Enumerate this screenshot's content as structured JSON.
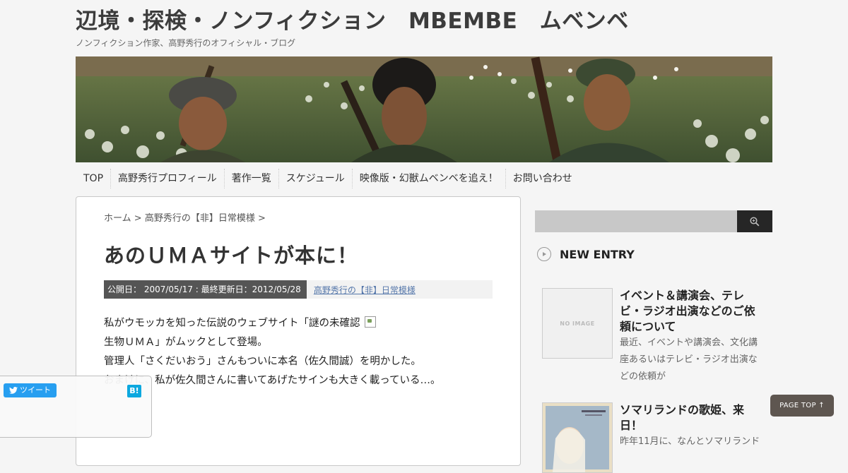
{
  "site": {
    "title": "辺境・探検・ノンフィクション　MBEMBE　ムベンベ",
    "description": "ノンフィクション作家、高野秀行のオフィシャル・ブログ"
  },
  "nav": {
    "items": [
      {
        "label": "TOP"
      },
      {
        "label": "高野秀行プロフィール"
      },
      {
        "label": "著作一覧"
      },
      {
        "label": "スケジュール"
      },
      {
        "label": "映像版・幻獣ムベンベを追え！"
      },
      {
        "label": "お問い合わせ"
      }
    ]
  },
  "breadcrumb": {
    "home": "ホーム",
    "sep": ">",
    "category": "高野秀行の【非】日常模様"
  },
  "post": {
    "title": "あのＵＭＡサイトが本に！",
    "dates": "公開日： 2007/05/17 : 最終更新日：2012/05/28",
    "category": "高野秀行の【非】日常模様",
    "paragraphs": [
      "私がウモッカを知った伝説のウェブサイト「謎の未確認",
      "生物ＵＭＡ」がムックとして登場。",
      "管理人「さくだいおう」さんもついに本名（佐久間誠）を明かした。",
      "おまけに、私が佐久間さんに書いてあげたサインも大きく載っている…。"
    ]
  },
  "share": {
    "tweet_label": "ツイート",
    "hatena_label": "B!"
  },
  "sidebar": {
    "widget_title": "NEW ENTRY",
    "entries": [
      {
        "title": "イベント＆講演会、テレビ・ラジオ出演などのご依頼について",
        "thumb_label": "NO IMAGE",
        "excerpt": "最近、イベントや講演会、文化講座あるいはテレビ・ラジオ出演などの依頼が"
      },
      {
        "title": "ソマリランドの歌姫、来日！",
        "excerpt": "昨年11月に、なんとソマリランド"
      }
    ]
  },
  "page_top": {
    "label": "PAGE TOP ↑"
  },
  "colors": {
    "accent_dark": "#262626",
    "meta_bg": "#555555",
    "link": "#5577aa",
    "page_top_bg": "#5e5650",
    "tweet_blue": "#1d9bf0",
    "hatena_blue": "#00a4de"
  }
}
